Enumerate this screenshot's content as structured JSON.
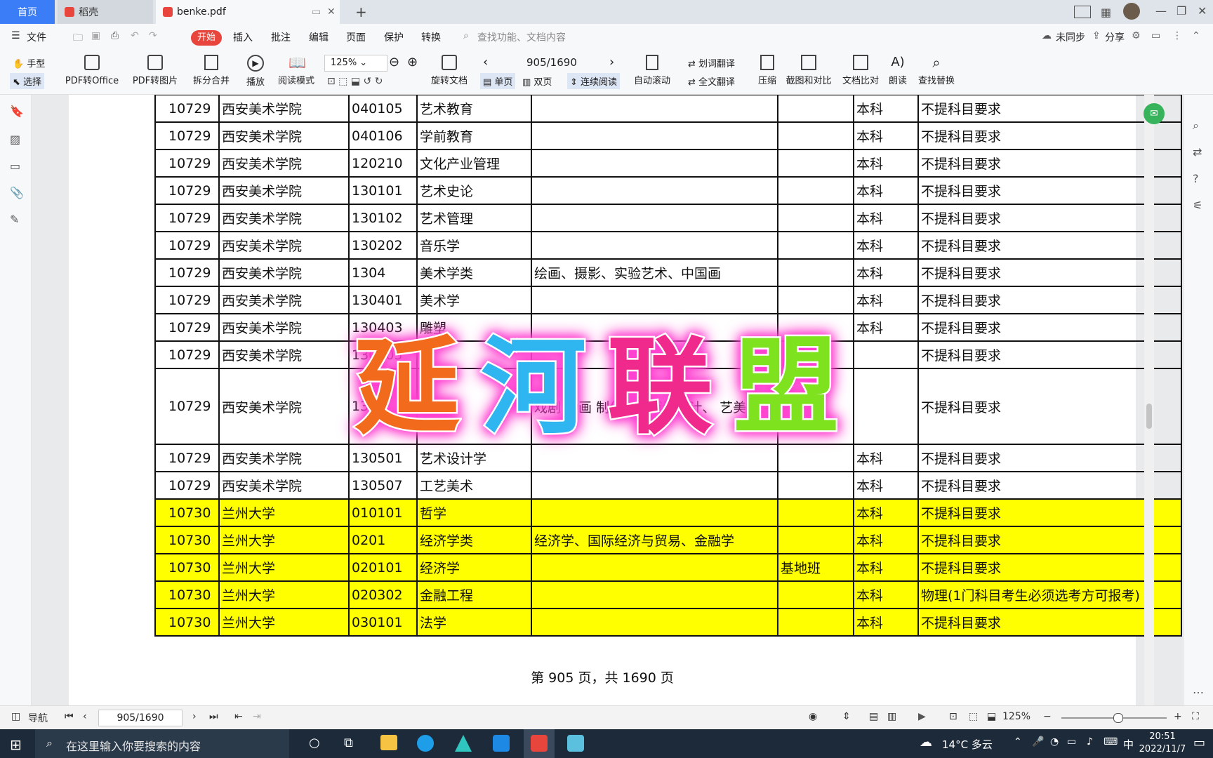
{
  "tabs": {
    "home": "首页",
    "daoke": "稻壳",
    "pdf": "benke.pdf",
    "add": "+"
  },
  "menu": {
    "file": "文件",
    "start": "开始",
    "items": [
      "插入",
      "批注",
      "编辑",
      "页面",
      "保护",
      "转换"
    ],
    "search_placeholder": "查找功能、文档内容",
    "sync": "未同步",
    "share": "分享"
  },
  "toolbar": {
    "hand": "手型",
    "select": "选择",
    "pdf_to_office": "PDF转Office",
    "pdf_to_image": "PDF转图片",
    "split_merge": "拆分合并",
    "play": "播放",
    "read_mode": "阅读模式",
    "zoom": "125%",
    "rotate": "旋转文档",
    "page_indicator": "905/1690",
    "single": "单页",
    "double": "双页",
    "continuous": "连续阅读",
    "auto_scroll": "自动滚动",
    "word_translate": "划词翻译",
    "full_translate": "全文翻译",
    "compress": "压缩",
    "screenshot_compare": "截图和对比",
    "doc_compare": "文档比对",
    "read_aloud": "朗读",
    "find_replace": "查找替换"
  },
  "table": {
    "rows": [
      {
        "code": "10729",
        "school": "西安美术学院",
        "major_code": "040105",
        "major": "艺术教育",
        "detail": "",
        "note": "",
        "level": "本科",
        "req": "不提科目要求",
        "hl": false
      },
      {
        "code": "10729",
        "school": "西安美术学院",
        "major_code": "040106",
        "major": "学前教育",
        "detail": "",
        "note": "",
        "level": "本科",
        "req": "不提科目要求",
        "hl": false
      },
      {
        "code": "10729",
        "school": "西安美术学院",
        "major_code": "120210",
        "major": "文化产业管理",
        "detail": "",
        "note": "",
        "level": "本科",
        "req": "不提科目要求",
        "hl": false
      },
      {
        "code": "10729",
        "school": "西安美术学院",
        "major_code": "130101",
        "major": "艺术史论",
        "detail": "",
        "note": "",
        "level": "本科",
        "req": "不提科目要求",
        "hl": false
      },
      {
        "code": "10729",
        "school": "西安美术学院",
        "major_code": "130102",
        "major": "艺术管理",
        "detail": "",
        "note": "",
        "level": "本科",
        "req": "不提科目要求",
        "hl": false
      },
      {
        "code": "10729",
        "school": "西安美术学院",
        "major_code": "130202",
        "major": "音乐学",
        "detail": "",
        "note": "",
        "level": "本科",
        "req": "不提科目要求",
        "hl": false
      },
      {
        "code": "10729",
        "school": "西安美术学院",
        "major_code": "1304",
        "major": "美术学类",
        "detail": "绘画、摄影、实验艺术、中国画",
        "note": "",
        "level": "本科",
        "req": "不提科目要求",
        "hl": false
      },
      {
        "code": "10729",
        "school": "西安美术学院",
        "major_code": "130401",
        "major": "美术学",
        "detail": "",
        "note": "",
        "level": "本科",
        "req": "不提科目要求",
        "hl": false
      },
      {
        "code": "10729",
        "school": "西安美术学院",
        "major_code": "130403",
        "major": "雕塑",
        "detail": "",
        "note": "",
        "level": "本科",
        "req": "不提科目要求",
        "hl": false
      },
      {
        "code": "10729",
        "school": "西安美术学院",
        "major_code": "130405",
        "major": "书",
        "detail": "",
        "note": "",
        "level": "",
        "req": "不提科目要求",
        "hl": false
      },
      {
        "code": "10729",
        "school": "西安美术学院",
        "major_code": "1305",
        "major": "设",
        "detail": "戏剧 动画 制作 、环 设计 计、 艺美 数字 术、",
        "note": "",
        "level": "",
        "req": "不提科目要求",
        "hl": false,
        "tall": true
      },
      {
        "code": "10729",
        "school": "西安美术学院",
        "major_code": "130501",
        "major": "艺术设计学",
        "detail": "",
        "note": "",
        "level": "本科",
        "req": "不提科目要求",
        "hl": false
      },
      {
        "code": "10729",
        "school": "西安美术学院",
        "major_code": "130507",
        "major": "工艺美术",
        "detail": "",
        "note": "",
        "level": "本科",
        "req": "不提科目要求",
        "hl": false
      },
      {
        "code": "10730",
        "school": "兰州大学",
        "major_code": "010101",
        "major": "哲学",
        "detail": "",
        "note": "",
        "level": "本科",
        "req": "不提科目要求",
        "hl": true
      },
      {
        "code": "10730",
        "school": "兰州大学",
        "major_code": "0201",
        "major": "经济学类",
        "detail": "经济学、国际经济与贸易、金融学",
        "note": "",
        "level": "本科",
        "req": "不提科目要求",
        "hl": true
      },
      {
        "code": "10730",
        "school": "兰州大学",
        "major_code": "020101",
        "major": "经济学",
        "detail": "",
        "note": "基地班",
        "level": "本科",
        "req": "不提科目要求",
        "hl": true
      },
      {
        "code": "10730",
        "school": "兰州大学",
        "major_code": "020302",
        "major": "金融工程",
        "detail": "",
        "note": "",
        "level": "本科",
        "req": "物理(1门科目考生必须选考方可报考)",
        "hl": true
      },
      {
        "code": "10730",
        "school": "兰州大学",
        "major_code": "030101",
        "major": "法学",
        "detail": "",
        "note": "",
        "level": "本科",
        "req": "不提科目要求",
        "hl": true
      }
    ],
    "footer": "第 905 页，共 1690 页"
  },
  "watermark": {
    "chars": [
      "延",
      "河",
      "联",
      "盟"
    ],
    "colors": [
      "#f26a1b",
      "#2fb6f0",
      "#f02a8c",
      "#7ee21f"
    ]
  },
  "status": {
    "nav": "导航",
    "page": "905/1690",
    "zoom": "125%"
  },
  "taskbar": {
    "search_placeholder": "在这里输入你要搜索的内容",
    "weather": "14°C 多云",
    "ime": "中",
    "time": "20:51",
    "date": "2022/11/7"
  }
}
